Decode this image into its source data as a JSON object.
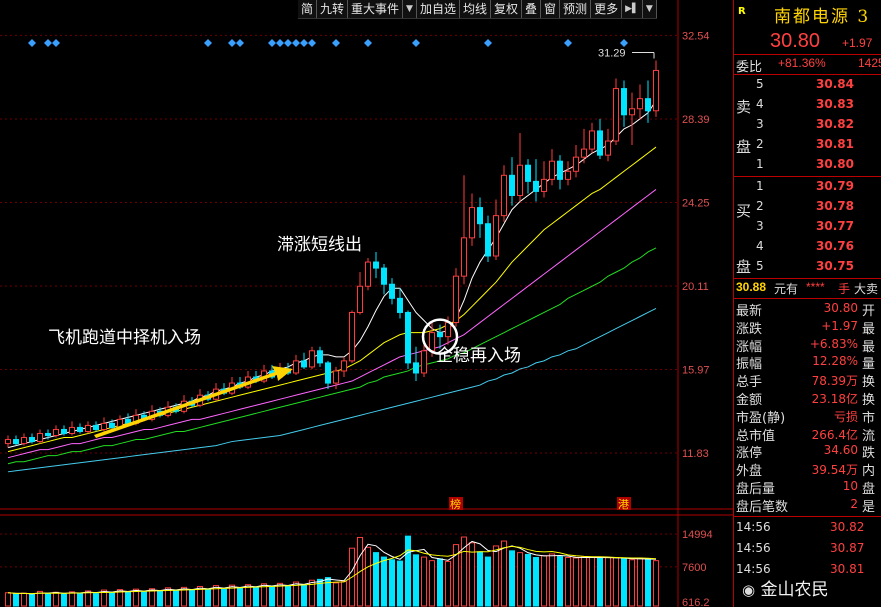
{
  "toolbar": {
    "items": [
      "简",
      "九转",
      "重大事件",
      "加自选",
      "均线",
      "复权",
      "叠",
      "窗",
      "预测",
      "更多"
    ]
  },
  "chart_data": {
    "type": "candlestick",
    "y_ticks": [
      "32.54",
      "28.39",
      "24.25",
      "20.11",
      "15.97",
      "11.83"
    ],
    "ylim": [
      9.8,
      33.3
    ],
    "volume_ticks": [
      "14994",
      "7600",
      "616.2"
    ],
    "volume_lim": [
      616.2,
      17000
    ],
    "high_label": "31.29",
    "event_markers": [
      "榜",
      "港"
    ],
    "candles": [
      {
        "o": 12.3,
        "c": 12.5,
        "h": 12.7,
        "l": 12.1
      },
      {
        "o": 12.5,
        "c": 12.3,
        "h": 12.7,
        "l": 12.2
      },
      {
        "o": 12.3,
        "c": 12.6,
        "h": 12.8,
        "l": 12.2
      },
      {
        "o": 12.6,
        "c": 12.4,
        "h": 12.8,
        "l": 12.3
      },
      {
        "o": 12.4,
        "c": 12.8,
        "h": 13.0,
        "l": 12.3
      },
      {
        "o": 12.8,
        "c": 12.7,
        "h": 13.0,
        "l": 12.5
      },
      {
        "o": 12.7,
        "c": 13.0,
        "h": 13.2,
        "l": 12.6
      },
      {
        "o": 13.0,
        "c": 12.8,
        "h": 13.2,
        "l": 12.7
      },
      {
        "o": 12.8,
        "c": 13.1,
        "h": 13.4,
        "l": 12.7
      },
      {
        "o": 13.1,
        "c": 12.9,
        "h": 13.3,
        "l": 12.8
      },
      {
        "o": 12.9,
        "c": 13.2,
        "h": 13.4,
        "l": 12.8
      },
      {
        "o": 13.2,
        "c": 13.0,
        "h": 13.4,
        "l": 12.9
      },
      {
        "o": 13.0,
        "c": 13.3,
        "h": 13.6,
        "l": 12.9
      },
      {
        "o": 13.3,
        "c": 13.1,
        "h": 13.5,
        "l": 13.0
      },
      {
        "o": 13.1,
        "c": 13.5,
        "h": 13.7,
        "l": 13.0
      },
      {
        "o": 13.5,
        "c": 13.3,
        "h": 13.8,
        "l": 13.2
      },
      {
        "o": 13.3,
        "c": 13.7,
        "h": 14.0,
        "l": 13.2
      },
      {
        "o": 13.7,
        "c": 13.5,
        "h": 13.9,
        "l": 13.4
      },
      {
        "o": 13.5,
        "c": 13.9,
        "h": 14.2,
        "l": 13.4
      },
      {
        "o": 13.9,
        "c": 13.7,
        "h": 14.1,
        "l": 13.6
      },
      {
        "o": 13.7,
        "c": 14.1,
        "h": 14.4,
        "l": 13.6
      },
      {
        "o": 14.1,
        "c": 13.9,
        "h": 14.3,
        "l": 13.8
      },
      {
        "o": 13.9,
        "c": 14.4,
        "h": 14.7,
        "l": 13.8
      },
      {
        "o": 14.4,
        "c": 14.2,
        "h": 14.6,
        "l": 14.1
      },
      {
        "o": 14.2,
        "c": 14.7,
        "h": 15.0,
        "l": 14.1
      },
      {
        "o": 14.7,
        "c": 14.5,
        "h": 14.9,
        "l": 14.4
      },
      {
        "o": 14.5,
        "c": 15.0,
        "h": 15.3,
        "l": 14.4
      },
      {
        "o": 15.0,
        "c": 14.8,
        "h": 15.3,
        "l": 14.7
      },
      {
        "o": 14.8,
        "c": 15.3,
        "h": 15.6,
        "l": 14.7
      },
      {
        "o": 15.3,
        "c": 15.1,
        "h": 15.6,
        "l": 15.0
      },
      {
        "o": 15.1,
        "c": 15.6,
        "h": 15.9,
        "l": 15.0
      },
      {
        "o": 15.6,
        "c": 15.4,
        "h": 15.9,
        "l": 15.3
      },
      {
        "o": 15.4,
        "c": 15.9,
        "h": 16.2,
        "l": 15.3
      },
      {
        "o": 15.9,
        "c": 15.6,
        "h": 16.2,
        "l": 15.5
      },
      {
        "o": 15.6,
        "c": 16.0,
        "h": 16.3,
        "l": 15.5
      },
      {
        "o": 16.0,
        "c": 15.8,
        "h": 16.3,
        "l": 15.7
      },
      {
        "o": 15.8,
        "c": 16.4,
        "h": 16.7,
        "l": 15.7
      },
      {
        "o": 16.4,
        "c": 16.1,
        "h": 16.8,
        "l": 16.0
      },
      {
        "o": 16.1,
        "c": 16.9,
        "h": 17.1,
        "l": 16.0
      },
      {
        "o": 16.9,
        "c": 16.3,
        "h": 17.1,
        "l": 16.1
      },
      {
        "o": 16.3,
        "c": 15.3,
        "h": 16.4,
        "l": 15.0
      },
      {
        "o": 15.3,
        "c": 15.9,
        "h": 16.1,
        "l": 15.0
      },
      {
        "o": 15.9,
        "c": 16.4,
        "h": 16.6,
        "l": 15.6
      },
      {
        "o": 16.4,
        "c": 18.8,
        "h": 18.9,
        "l": 16.3
      },
      {
        "o": 18.8,
        "c": 20.1,
        "h": 20.8,
        "l": 18.7
      },
      {
        "o": 20.1,
        "c": 21.3,
        "h": 21.5,
        "l": 19.9
      },
      {
        "o": 21.3,
        "c": 21.0,
        "h": 21.8,
        "l": 20.5
      },
      {
        "o": 21.0,
        "c": 20.2,
        "h": 21.2,
        "l": 19.7
      },
      {
        "o": 20.2,
        "c": 19.5,
        "h": 20.5,
        "l": 19.2
      },
      {
        "o": 19.5,
        "c": 18.8,
        "h": 20.0,
        "l": 18.5
      },
      {
        "o": 18.8,
        "c": 16.3,
        "h": 18.9,
        "l": 16.0
      },
      {
        "o": 16.3,
        "c": 15.8,
        "h": 17.1,
        "l": 15.4
      },
      {
        "o": 15.8,
        "c": 16.9,
        "h": 17.3,
        "l": 15.6
      },
      {
        "o": 16.9,
        "c": 17.8,
        "h": 18.4,
        "l": 16.6
      },
      {
        "o": 17.8,
        "c": 17.6,
        "h": 18.2,
        "l": 17.0
      },
      {
        "o": 17.6,
        "c": 18.3,
        "h": 18.6,
        "l": 17.2
      },
      {
        "o": 18.3,
        "c": 20.6,
        "h": 21.0,
        "l": 18.1
      },
      {
        "o": 20.6,
        "c": 22.5,
        "h": 25.6,
        "l": 20.2
      },
      {
        "o": 22.5,
        "c": 24.0,
        "h": 24.7,
        "l": 22.1
      },
      {
        "o": 24.0,
        "c": 23.2,
        "h": 24.5,
        "l": 22.5
      },
      {
        "o": 23.2,
        "c": 21.6,
        "h": 23.6,
        "l": 21.3
      },
      {
        "o": 21.6,
        "c": 23.6,
        "h": 24.4,
        "l": 21.4
      },
      {
        "o": 23.6,
        "c": 25.6,
        "h": 26.1,
        "l": 23.3
      },
      {
        "o": 25.6,
        "c": 24.6,
        "h": 26.5,
        "l": 24.1
      },
      {
        "o": 24.6,
        "c": 26.1,
        "h": 27.7,
        "l": 24.3
      },
      {
        "o": 26.1,
        "c": 25.3,
        "h": 26.4,
        "l": 24.7
      },
      {
        "o": 25.3,
        "c": 24.8,
        "h": 26.4,
        "l": 24.3
      },
      {
        "o": 24.8,
        "c": 25.4,
        "h": 26.3,
        "l": 24.5
      },
      {
        "o": 25.4,
        "c": 26.3,
        "h": 26.9,
        "l": 25.1
      },
      {
        "o": 26.3,
        "c": 25.4,
        "h": 26.6,
        "l": 24.9
      },
      {
        "o": 25.4,
        "c": 25.8,
        "h": 26.3,
        "l": 25.1
      },
      {
        "o": 25.8,
        "c": 26.5,
        "h": 27.1,
        "l": 25.5
      },
      {
        "o": 26.5,
        "c": 26.9,
        "h": 27.9,
        "l": 26.2
      },
      {
        "o": 26.9,
        "c": 27.8,
        "h": 28.2,
        "l": 26.7
      },
      {
        "o": 27.8,
        "c": 26.6,
        "h": 28.4,
        "l": 26.4
      },
      {
        "o": 26.6,
        "c": 27.3,
        "h": 27.9,
        "l": 26.3
      },
      {
        "o": 27.3,
        "c": 29.9,
        "h": 30.4,
        "l": 27.1
      },
      {
        "o": 29.9,
        "c": 28.6,
        "h": 30.3,
        "l": 28.0
      },
      {
        "o": 28.6,
        "c": 28.9,
        "h": 29.7,
        "l": 27.1
      },
      {
        "o": 28.9,
        "c": 29.4,
        "h": 30.1,
        "l": 28.4
      },
      {
        "o": 29.4,
        "c": 28.8,
        "h": 30.3,
        "l": 28.2
      },
      {
        "o": 28.8,
        "c": 30.8,
        "h": 31.29,
        "l": 28.5
      }
    ],
    "ma_lines": [
      {
        "color": "#ffffff",
        "values": [
          12.1,
          12.2,
          12.3,
          12.4,
          12.5,
          12.6,
          12.7,
          12.8,
          12.9,
          13.0,
          13.1,
          13.2,
          13.3,
          13.4,
          13.5,
          13.6,
          13.7,
          13.8,
          13.9,
          14.0,
          14.1,
          14.2,
          14.3,
          14.4,
          14.6,
          14.7,
          14.9,
          15.0,
          15.1,
          15.3,
          15.4,
          15.6,
          15.7,
          15.9,
          16.0,
          16.1,
          16.3,
          16.4,
          16.6,
          16.7,
          16.7,
          16.6,
          16.6,
          16.9,
          17.4,
          18.1,
          18.9,
          19.6,
          20.0,
          20.0,
          19.4,
          18.8,
          18.4,
          18.0,
          17.8,
          17.9,
          18.5,
          19.4,
          20.5,
          21.3,
          21.9,
          22.5,
          23.2,
          23.9,
          24.3,
          24.6,
          24.9,
          25.2,
          25.5,
          25.7,
          25.9,
          26.1,
          26.4,
          26.7,
          26.9,
          27.1,
          27.5,
          27.9,
          28.1,
          28.4,
          28.7,
          29.3
        ]
      },
      {
        "color": "#ffff00",
        "values": [
          11.9,
          12.0,
          12.1,
          12.2,
          12.3,
          12.4,
          12.5,
          12.6,
          12.6,
          12.7,
          12.8,
          12.9,
          13.0,
          13.1,
          13.2,
          13.3,
          13.4,
          13.5,
          13.6,
          13.7,
          13.8,
          13.9,
          14.0,
          14.1,
          14.2,
          14.3,
          14.4,
          14.5,
          14.6,
          14.7,
          14.8,
          14.9,
          15.0,
          15.1,
          15.2,
          15.3,
          15.4,
          15.5,
          15.6,
          15.7,
          15.8,
          15.9,
          16.0,
          16.2,
          16.4,
          16.7,
          17.0,
          17.3,
          17.5,
          17.7,
          17.8,
          17.8,
          17.8,
          17.9,
          18.0,
          18.2,
          18.4,
          18.7,
          19.1,
          19.5,
          19.9,
          20.3,
          20.8,
          21.3,
          21.7,
          22.1,
          22.5,
          22.9,
          23.2,
          23.5,
          23.8,
          24.1,
          24.4,
          24.7,
          24.9,
          25.2,
          25.5,
          25.8,
          26.1,
          26.4,
          26.7,
          27.0
        ]
      },
      {
        "color": "#ff66ff",
        "values": [
          11.6,
          11.7,
          11.8,
          11.9,
          12.0,
          12.0,
          12.1,
          12.2,
          12.3,
          12.3,
          12.4,
          12.5,
          12.6,
          12.6,
          12.7,
          12.8,
          12.9,
          13.0,
          13.0,
          13.1,
          13.2,
          13.3,
          13.4,
          13.5,
          13.5,
          13.6,
          13.7,
          13.8,
          13.9,
          14.0,
          14.1,
          14.2,
          14.3,
          14.4,
          14.5,
          14.6,
          14.7,
          14.8,
          14.9,
          15.0,
          15.1,
          15.2,
          15.3,
          15.4,
          15.6,
          15.8,
          16.0,
          16.2,
          16.4,
          16.6,
          16.7,
          16.8,
          16.9,
          17.0,
          17.1,
          17.3,
          17.5,
          17.7,
          18.0,
          18.3,
          18.6,
          18.9,
          19.2,
          19.5,
          19.8,
          20.1,
          20.4,
          20.7,
          21.0,
          21.3,
          21.6,
          21.9,
          22.2,
          22.5,
          22.8,
          23.1,
          23.4,
          23.7,
          24.0,
          24.3,
          24.6,
          24.9
        ]
      },
      {
        "color": "#22dd22",
        "values": [
          11.3,
          11.4,
          11.4,
          11.5,
          11.6,
          11.7,
          11.7,
          11.8,
          11.9,
          11.9,
          12.0,
          12.1,
          12.2,
          12.2,
          12.3,
          12.4,
          12.5,
          12.5,
          12.6,
          12.7,
          12.8,
          12.9,
          12.9,
          13.0,
          13.1,
          13.2,
          13.3,
          13.4,
          13.5,
          13.6,
          13.7,
          13.8,
          13.9,
          14.0,
          14.1,
          14.2,
          14.3,
          14.4,
          14.5,
          14.6,
          14.7,
          14.8,
          14.9,
          15.0,
          15.1,
          15.3,
          15.4,
          15.6,
          15.7,
          15.8,
          15.9,
          16.1,
          16.2,
          16.3,
          16.4,
          16.5,
          16.7,
          16.8,
          17.0,
          17.2,
          17.4,
          17.6,
          17.8,
          18.0,
          18.2,
          18.4,
          18.6,
          18.8,
          19.0,
          19.2,
          19.5,
          19.7,
          19.9,
          20.1,
          20.3,
          20.6,
          20.8,
          21.0,
          21.3,
          21.5,
          21.8,
          22.0
        ]
      },
      {
        "color": "#44ccee",
        "values": [
          10.9,
          10.95,
          11.0,
          11.05,
          11.1,
          11.15,
          11.2,
          11.25,
          11.3,
          11.35,
          11.4,
          11.45,
          11.5,
          11.55,
          11.6,
          11.65,
          11.7,
          11.75,
          11.8,
          11.85,
          11.9,
          11.95,
          12.0,
          12.05,
          12.1,
          12.15,
          12.2,
          12.3,
          12.4,
          12.45,
          12.5,
          12.55,
          12.6,
          12.65,
          12.7,
          12.8,
          12.9,
          13.0,
          13.1,
          13.2,
          13.3,
          13.4,
          13.5,
          13.6,
          13.7,
          13.8,
          13.9,
          14.0,
          14.1,
          14.2,
          14.3,
          14.4,
          14.5,
          14.6,
          14.7,
          14.8,
          14.9,
          15.0,
          15.1,
          15.2,
          15.4,
          15.5,
          15.7,
          15.8,
          16.0,
          16.1,
          16.3,
          16.4,
          16.6,
          16.7,
          16.9,
          17.0,
          17.2,
          17.4,
          17.6,
          17.8,
          18.0,
          18.2,
          18.4,
          18.6,
          18.8,
          19.0
        ]
      }
    ],
    "volumes": [
      1800,
      1500,
      1700,
      1400,
      2100,
      1600,
      1900,
      1500,
      2000,
      1700,
      2200,
      1600,
      2400,
      1800,
      2500,
      1900,
      2600,
      2000,
      2700,
      2100,
      2900,
      2200,
      3000,
      2300,
      3200,
      2500,
      3400,
      2600,
      3500,
      2800,
      3600,
      3000,
      3800,
      3100,
      3900,
      3300,
      4200,
      3500,
      4600,
      4800,
      5200,
      4000,
      4300,
      11800,
      14200,
      12000,
      10800,
      9800,
      9200,
      8900,
      14500,
      10300,
      9800,
      9000,
      9400,
      8800,
      12600,
      14300,
      13000,
      11000,
      9800,
      12300,
      13400,
      11200,
      10800,
      10400,
      9700,
      10100,
      10500,
      9900,
      9700,
      9600,
      9800,
      9800,
      9500,
      9700,
      9700,
      9400,
      9200,
      9600,
      9300,
      9000
    ],
    "diamond_positions": [
      3,
      5,
      6,
      25,
      28,
      29,
      33,
      34,
      35,
      36,
      37,
      38,
      41,
      45,
      51,
      60,
      70,
      77
    ]
  },
  "annotations": {
    "flight_runway": "飞机跑道中择机入场",
    "stall_exit": "滞涨短线出",
    "stable_reentry": "企稳再入场"
  },
  "panel": {
    "badge": "R",
    "stock_name": "南都电源 3",
    "price": "30.80",
    "change": "+1.97",
    "weibi_label": "委比",
    "weibi_val": "+81.36%",
    "weicha_val": "1425",
    "sell_side": [
      "卖",
      "盘"
    ],
    "buy_side": [
      "买",
      "盘"
    ],
    "asks": [
      {
        "idx": "5",
        "price": "30.84"
      },
      {
        "idx": "4",
        "price": "30.83"
      },
      {
        "idx": "3",
        "price": "30.82"
      },
      {
        "idx": "2",
        "price": "30.81"
      },
      {
        "idx": "1",
        "price": "30.80"
      }
    ],
    "bids": [
      {
        "idx": "1",
        "price": "30.79"
      },
      {
        "idx": "2",
        "price": "30.78"
      },
      {
        "idx": "3",
        "price": "30.77"
      },
      {
        "idx": "4",
        "price": "30.76"
      },
      {
        "idx": "5",
        "price": "30.75"
      }
    ],
    "big_order": {
      "price": "30.88",
      "unit": "元有",
      "stars": "****",
      "hand": "手",
      "tail": "大卖"
    },
    "stats": [
      {
        "label": "最新",
        "value": "30.80",
        "cut": "开"
      },
      {
        "label": "涨跌",
        "value": "+1.97",
        "cut": "最"
      },
      {
        "label": "涨幅",
        "value": "+6.83%",
        "cut": "最"
      },
      {
        "label": "振幅",
        "value": "12.28%",
        "cut": "量"
      },
      {
        "label": "总手",
        "value": "78.39万",
        "cut": "换"
      },
      {
        "label": "金额",
        "value": "23.18亿",
        "cut": "换"
      },
      {
        "label": "市盈(静)",
        "value": "亏损",
        "cut": "市"
      },
      {
        "label": "总市值",
        "value": "266.4亿",
        "cut": "流"
      },
      {
        "label": "涨停",
        "value": "34.60",
        "cut": "跌"
      },
      {
        "label": "外盘",
        "value": "39.54万",
        "cut": "内"
      },
      {
        "label": "盘后量",
        "value": "10",
        "cut": "盘"
      },
      {
        "label": "盘后笔数",
        "value": "2",
        "cut": "是"
      }
    ],
    "ticks": [
      {
        "time": "14:56",
        "price": "30.82"
      },
      {
        "time": "14:56",
        "price": "30.87"
      },
      {
        "time": "14:56",
        "price": "30.81"
      }
    ]
  },
  "watermark": "金山农民",
  "colors": {
    "up": "#ff3b3b",
    "down": "#00e5ff",
    "accent": "#ffd400",
    "grid": "#8b0000"
  }
}
